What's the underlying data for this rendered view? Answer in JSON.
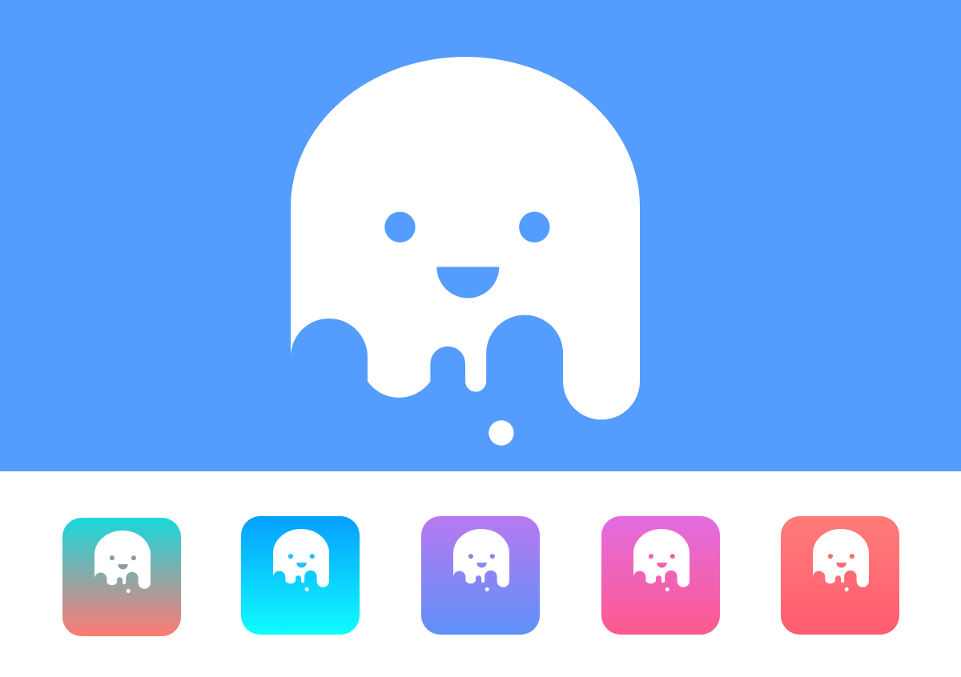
{
  "hero": {
    "background": "#549cfe",
    "ghost_color": "#ffffff",
    "icon": "ghost-mascot-icon"
  },
  "app_icons": [
    {
      "name": "teal-coral",
      "gradient": [
        "#18d8dc",
        "#ff7a72"
      ],
      "face_color": "#8c9aa6"
    },
    {
      "name": "blue-cyan",
      "gradient": [
        "#069fff",
        "#0ffcff"
      ],
      "face_color": "#27bff5"
    },
    {
      "name": "purple-blue",
      "gradient": [
        "#b879f0",
        "#5d91f8"
      ],
      "face_color": "#8a86f2"
    },
    {
      "name": "magenta-pink",
      "gradient": [
        "#e26ce0",
        "#fe5a8e"
      ],
      "face_color": "#f160b4"
    },
    {
      "name": "salmon-red",
      "gradient": [
        "#ff7c78",
        "#ff5c70"
      ],
      "face_color": "#ff6a74"
    }
  ]
}
